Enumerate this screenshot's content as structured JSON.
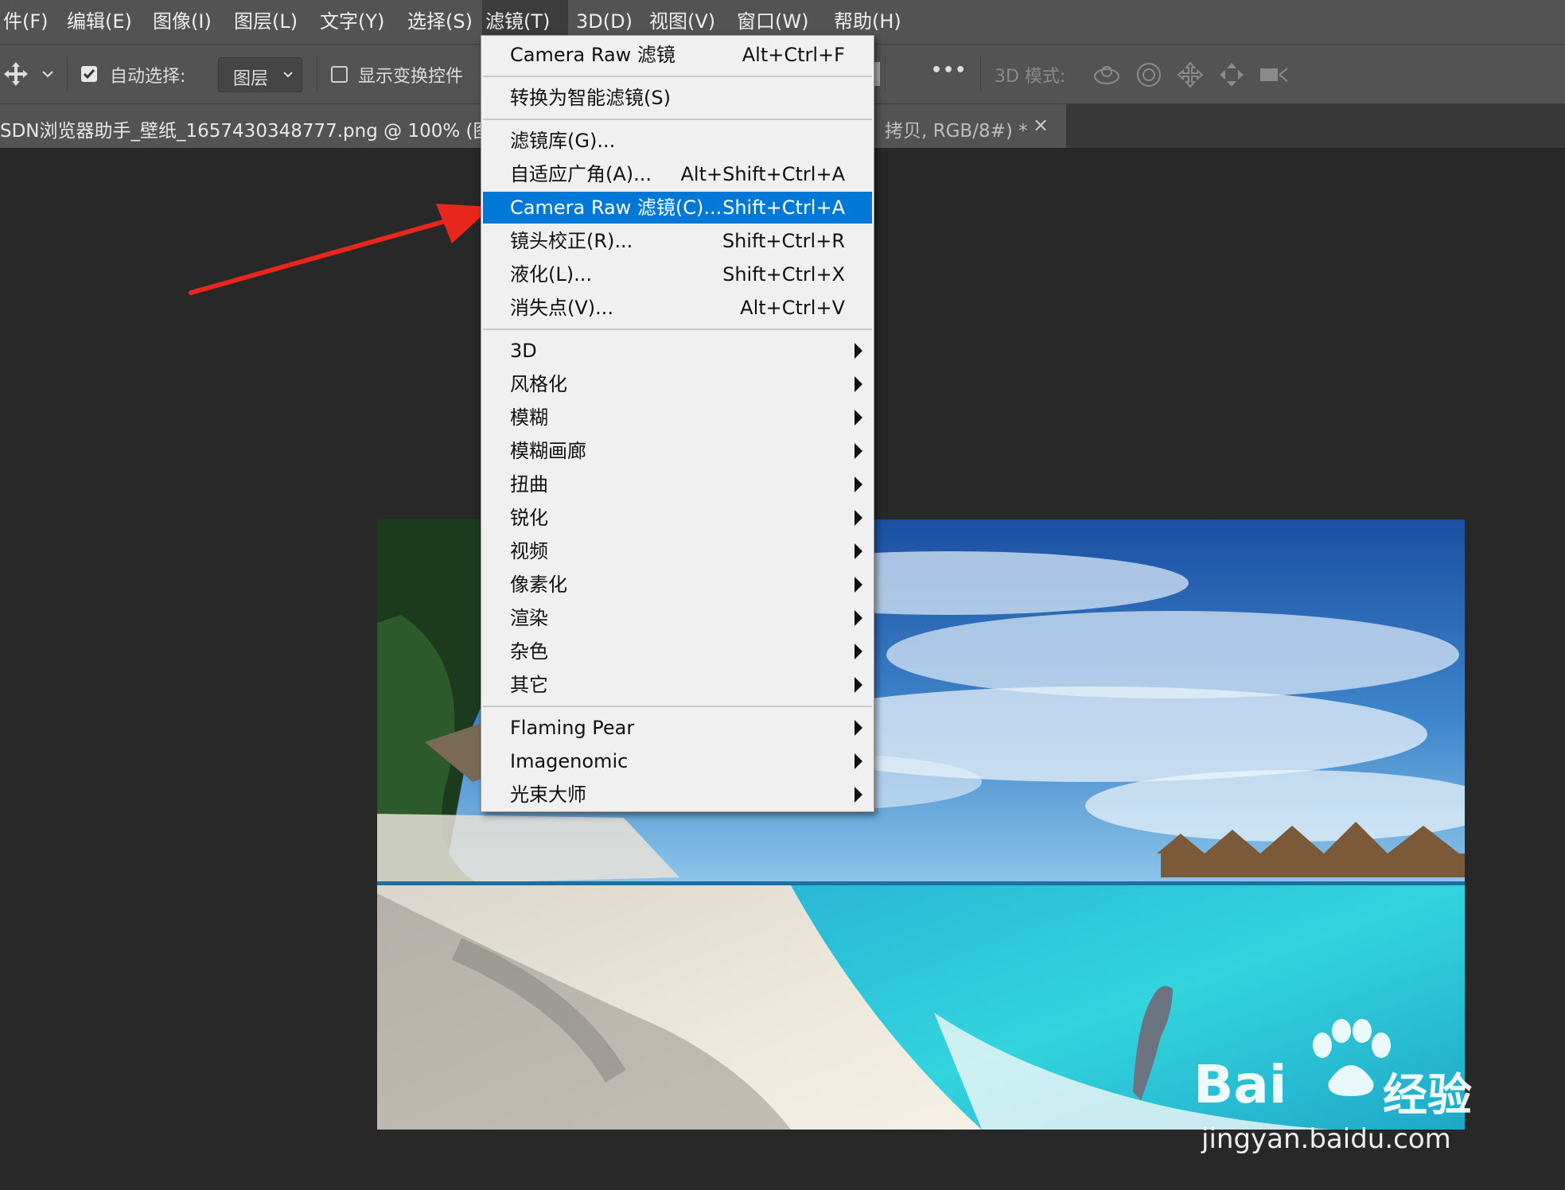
{
  "menubar": {
    "items": [
      {
        "label": "件(F)"
      },
      {
        "label": "编辑(E)"
      },
      {
        "label": "图像(I)"
      },
      {
        "label": "图层(L)"
      },
      {
        "label": "文字(Y)"
      },
      {
        "label": "选择(S)"
      },
      {
        "label": "滤镜(T)",
        "active": true
      },
      {
        "label": "3D(D)"
      },
      {
        "label": "视图(V)"
      },
      {
        "label": "窗口(W)"
      },
      {
        "label": "帮助(H)"
      }
    ]
  },
  "options_bar": {
    "move_tool_icon": "move-icon",
    "auto_select_checked": true,
    "auto_select_label": "自动选择:",
    "auto_select_target": "图层",
    "show_transform_checked": false,
    "show_transform_label": "显示变换控件",
    "more_glyph": "•••",
    "mode_3d_label": "3D 模式:"
  },
  "document_tab": {
    "title": "SDN浏览器助手_壁纸_1657430348777.png @ 100% (图",
    "title_suffix": "拷贝, RGB/8#) *",
    "close_glyph": "×"
  },
  "filter_menu": {
    "groups": [
      [
        {
          "label": "Camera Raw 滤镜",
          "shortcut": "Alt+Ctrl+F"
        }
      ],
      [
        {
          "label": "转换为智能滤镜(S)",
          "shortcut": ""
        }
      ],
      [
        {
          "label": "滤镜库(G)...",
          "shortcut": ""
        },
        {
          "label": "自适应广角(A)...",
          "shortcut": "Alt+Shift+Ctrl+A"
        },
        {
          "label": "Camera Raw 滤镜(C)...",
          "shortcut": "Shift+Ctrl+A",
          "highlighted": true
        },
        {
          "label": "镜头校正(R)...",
          "shortcut": "Shift+Ctrl+R"
        },
        {
          "label": "液化(L)...",
          "shortcut": "Shift+Ctrl+X"
        },
        {
          "label": "消失点(V)...",
          "shortcut": "Alt+Ctrl+V"
        }
      ],
      [
        {
          "label": "3D",
          "submenu": true
        },
        {
          "label": "风格化",
          "submenu": true
        },
        {
          "label": "模糊",
          "submenu": true
        },
        {
          "label": "模糊画廊",
          "submenu": true
        },
        {
          "label": "扭曲",
          "submenu": true
        },
        {
          "label": "锐化",
          "submenu": true
        },
        {
          "label": "视频",
          "submenu": true
        },
        {
          "label": "像素化",
          "submenu": true
        },
        {
          "label": "渲染",
          "submenu": true
        },
        {
          "label": "杂色",
          "submenu": true
        },
        {
          "label": "其它",
          "submenu": true
        }
      ],
      [
        {
          "label": "Flaming Pear",
          "submenu": true
        },
        {
          "label": "Imagenomic",
          "submenu": true
        },
        {
          "label": "光束大师",
          "submenu": true
        }
      ]
    ]
  },
  "annotation": {
    "arrow_color": "#e8261c"
  },
  "watermark": {
    "brand": "Bai",
    "brand_tail": "经验",
    "url": "jingyan.baidu.com"
  },
  "colors": {
    "menubar_bg": "#535353",
    "workspace_bg": "#282828",
    "menu_bg": "#f0f0f0",
    "highlight": "#0078d7"
  }
}
